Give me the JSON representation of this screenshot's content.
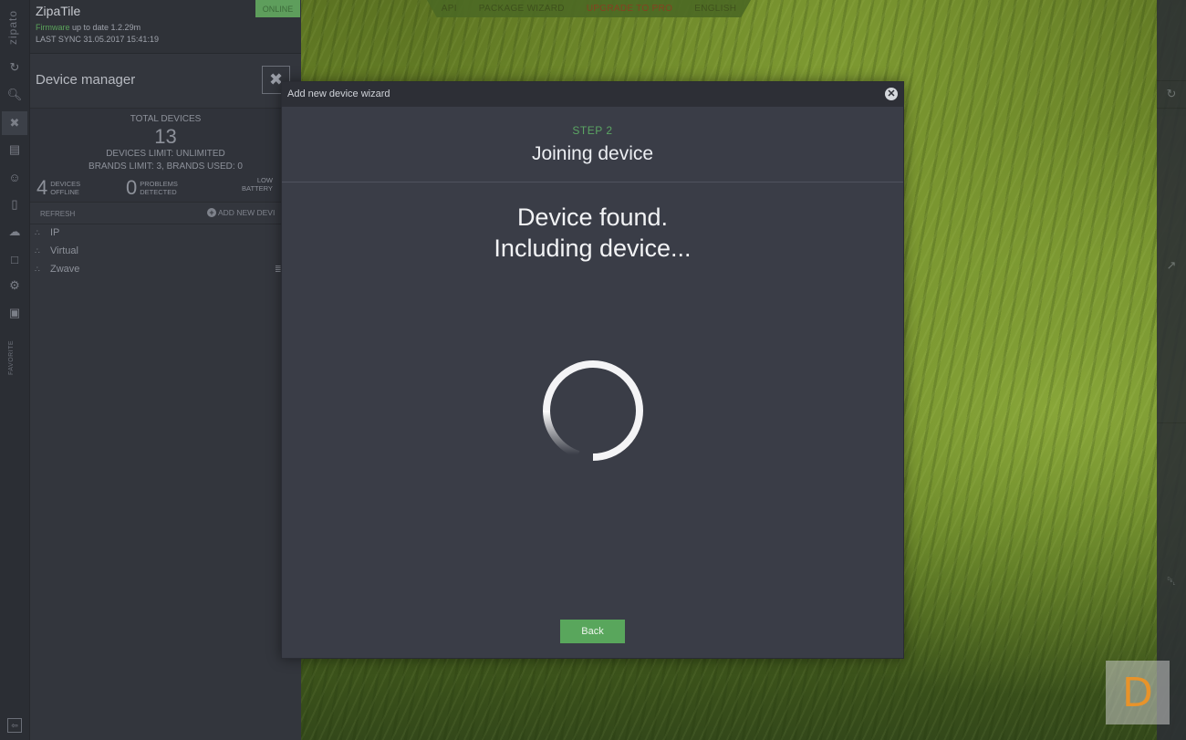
{
  "app": {
    "brand_vertical": "zipato",
    "name": "ZipaTile",
    "firmware_label": "Firmware",
    "firmware_status": "up to date 1.2.29m",
    "last_sync_label": "LAST SYNC",
    "last_sync_value": "31.05.2017 15:41:19",
    "online_badge": "ONLINE"
  },
  "top_nav": {
    "items": [
      "API",
      "PACKAGE WIZARD",
      "UPGRADE TO PRO",
      "ENGLISH"
    ],
    "upgrade_color": "#8a3b21"
  },
  "icon_strip": {
    "favorite_label": "FAVORITE"
  },
  "device_manager": {
    "title": "Device manager",
    "total_label": "TOTAL DEVICES",
    "total_value": "13",
    "devices_limit": "DEVICES LIMIT: UNLIMITED",
    "brands_limit": "BRANDS LIMIT: 3, BRANDS USED: 0",
    "offline_count": "4",
    "offline_label_1": "DEVICES",
    "offline_label_2": "OFFLINE",
    "problems_count": "0",
    "problems_label_1": "PROBLEMS",
    "problems_label_2": "DETECTED",
    "low_label_1": "LOW",
    "low_label_2": "BATTERY",
    "refresh_label": "REFRESH",
    "add_new_label": "ADD NEW DEVI",
    "tree": [
      {
        "label": "IP"
      },
      {
        "label": "Virtual"
      },
      {
        "label": "Zwave"
      }
    ]
  },
  "modal": {
    "title": "Add new device wizard",
    "close_icon": "close-icon",
    "step_label": "STEP 2",
    "step_title": "Joining device",
    "status_line_1": "Device found.",
    "status_line_2": "Including device...",
    "back_label": "Back",
    "accent_color": "#59a65c"
  },
  "watermark": {
    "letter": "D"
  }
}
